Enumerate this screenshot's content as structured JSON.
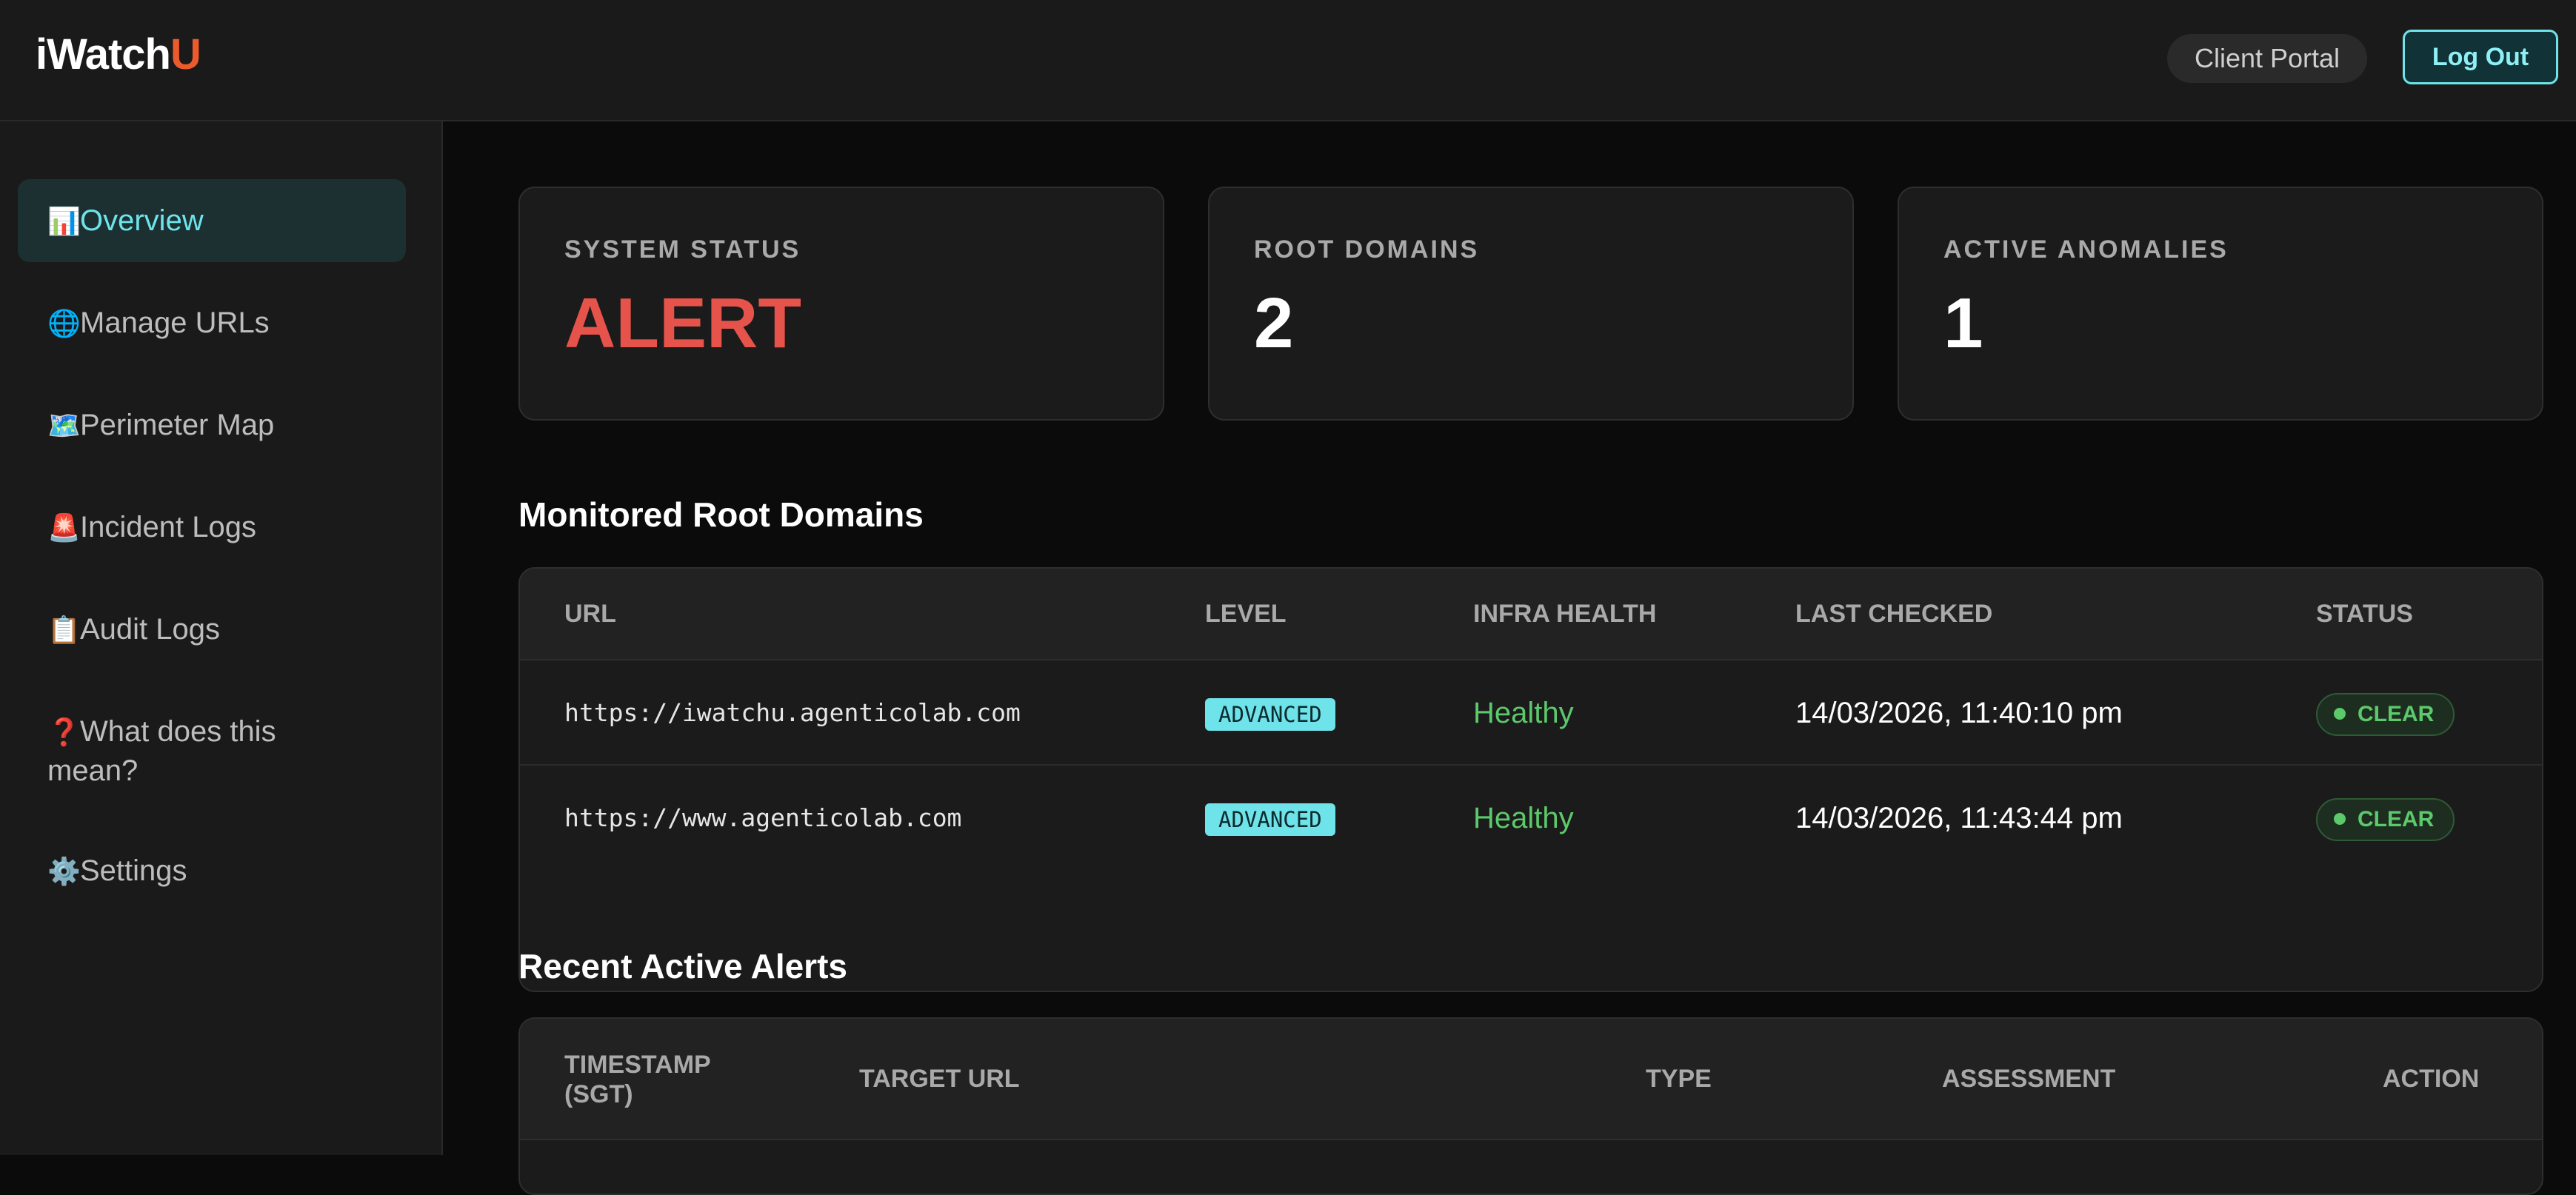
{
  "app": {
    "logo_main": "iWatch",
    "logo_accent": "U",
    "client_portal_label": "Client Portal",
    "logout_label": "Log Out"
  },
  "sidebar": {
    "items": [
      {
        "icon": "📊",
        "label": "Overview",
        "active": true
      },
      {
        "icon": "🌐",
        "label": "Manage URLs"
      },
      {
        "icon": "🗺️",
        "label": "Perimeter Map"
      },
      {
        "icon": "🚨",
        "label": "Incident Logs"
      },
      {
        "icon": "📋",
        "label": "Audit Logs"
      },
      {
        "icon": "❓",
        "label": "What does this mean?"
      },
      {
        "icon": "⚙️",
        "label": "Settings"
      }
    ]
  },
  "stats": [
    {
      "label": "SYSTEM STATUS",
      "value": "ALERT"
    },
    {
      "label": "ROOT DOMAINS",
      "value": "2"
    },
    {
      "label": "ACTIVE ANOMALIES",
      "value": "1"
    }
  ],
  "domains": {
    "title": "Monitored Root Domains",
    "columns": [
      "URL",
      "LEVEL",
      "INFRA HEALTH",
      "LAST CHECKED",
      "STATUS"
    ],
    "rows": [
      {
        "url": "https://iwatchu.agenticolab.com",
        "level": "ADVANCED",
        "health": "Healthy",
        "last_checked": "14/03/2026, 11:40:10 pm",
        "status": "CLEAR"
      },
      {
        "url": "https://www.agenticolab.com",
        "level": "ADVANCED",
        "health": "Healthy",
        "last_checked": "14/03/2026, 11:43:44 pm",
        "status": "CLEAR"
      }
    ]
  },
  "alerts": {
    "title": "Recent Active Alerts",
    "columns": [
      "TIMESTAMP (SGT)",
      "TARGET URL",
      "TYPE",
      "ASSESSMENT",
      "ACTION"
    ]
  },
  "colors": {
    "accent": "#6fe3ea",
    "brand": "#ec5b2c",
    "alert": "#e5534b",
    "healthy": "#5cc96b"
  }
}
